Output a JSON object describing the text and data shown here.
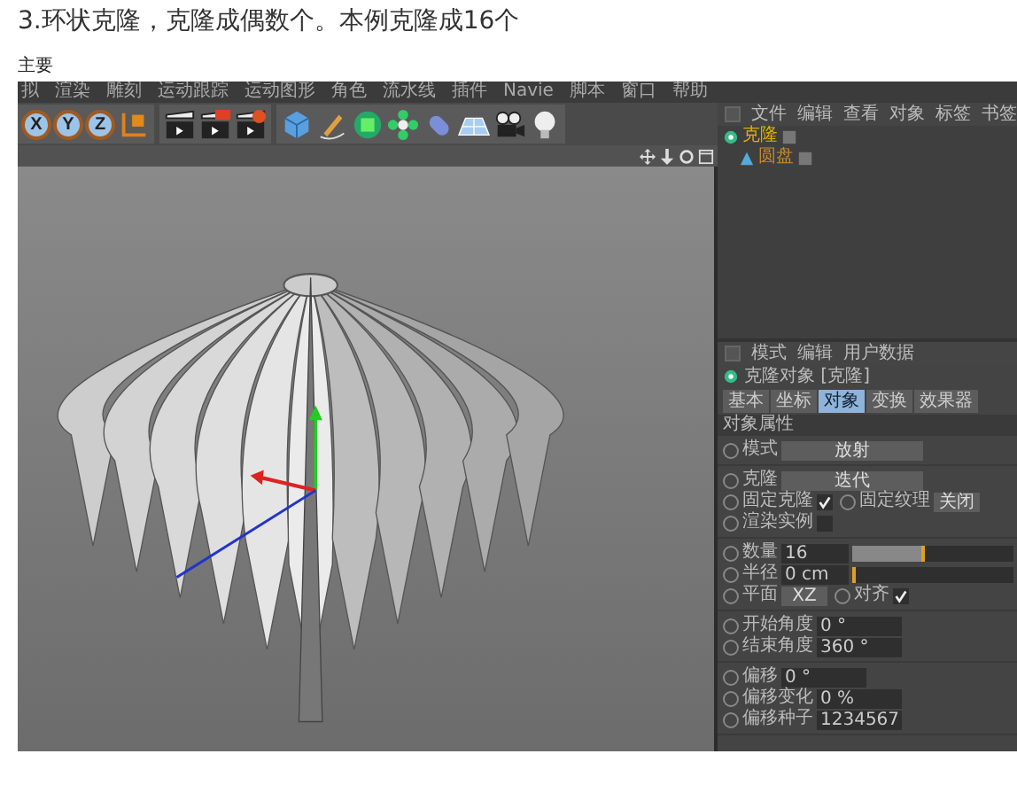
{
  "heading": "3.环状克隆，克隆成偶数个。本例克隆成16个",
  "section_label": "主要",
  "menu": [
    "拟",
    "渲染",
    "雕刻",
    "运动跟踪",
    "运动图形",
    "角色",
    "流水线",
    "插件",
    "Navie",
    "脚本",
    "窗口",
    "帮助"
  ],
  "axis_buttons": [
    "X",
    "Y",
    "Z"
  ],
  "object_manager": {
    "menu": [
      "文件",
      "编辑",
      "查看",
      "对象",
      "标签",
      "书签"
    ],
    "objects": [
      {
        "name": "克隆",
        "children": [
          {
            "name": "圆盘"
          }
        ]
      }
    ]
  },
  "attributes": {
    "menu": [
      "模式",
      "编辑",
      "用户数据"
    ],
    "title": "克隆对象 [克隆]",
    "tabs": [
      {
        "label": "基本",
        "selected": false
      },
      {
        "label": "坐标",
        "selected": false
      },
      {
        "label": "对象",
        "selected": true
      },
      {
        "label": "变换",
        "selected": false
      },
      {
        "label": "效果器",
        "selected": false
      }
    ],
    "section": "对象属性",
    "groups": [
      [
        {
          "items": [
            {
              "kind": "select",
              "label": "模式",
              "value": "放射"
            }
          ]
        }
      ],
      [
        {
          "items": [
            {
              "kind": "select",
              "label": "克隆",
              "value": "迭代"
            }
          ]
        },
        {
          "items": [
            {
              "kind": "check",
              "label": "固定克隆",
              "checked": true
            },
            {
              "kind": "select",
              "label": "固定纹理",
              "value": "关闭"
            }
          ]
        },
        {
          "items": [
            {
              "kind": "check",
              "label": "渲染实例",
              "checked": false
            }
          ]
        }
      ],
      [
        {
          "items": [
            {
              "kind": "slider",
              "label": "数量",
              "value": "16",
              "level": 0.45
            }
          ]
        },
        {
          "items": [
            {
              "kind": "slider",
              "label": "半径",
              "value": "0 cm",
              "level": 0
            }
          ]
        },
        {
          "items": [
            {
              "kind": "select",
              "label": "平面",
              "value": "XZ"
            },
            {
              "kind": "check",
              "label": "对齐",
              "checked": true
            }
          ]
        }
      ],
      [
        {
          "items": [
            {
              "kind": "number",
              "label": "开始角度",
              "value": "0 °"
            }
          ]
        },
        {
          "items": [
            {
              "kind": "number",
              "label": "结束角度",
              "value": "360 °"
            }
          ]
        }
      ],
      [
        {
          "items": [
            {
              "kind": "number",
              "label": "偏移",
              "value": "0 °"
            }
          ]
        },
        {
          "items": [
            {
              "kind": "number",
              "label": "偏移变化",
              "value": "0 %"
            }
          ]
        },
        {
          "items": [
            {
              "kind": "number",
              "label": "偏移种子",
              "value": "1234567"
            }
          ]
        }
      ]
    ]
  }
}
